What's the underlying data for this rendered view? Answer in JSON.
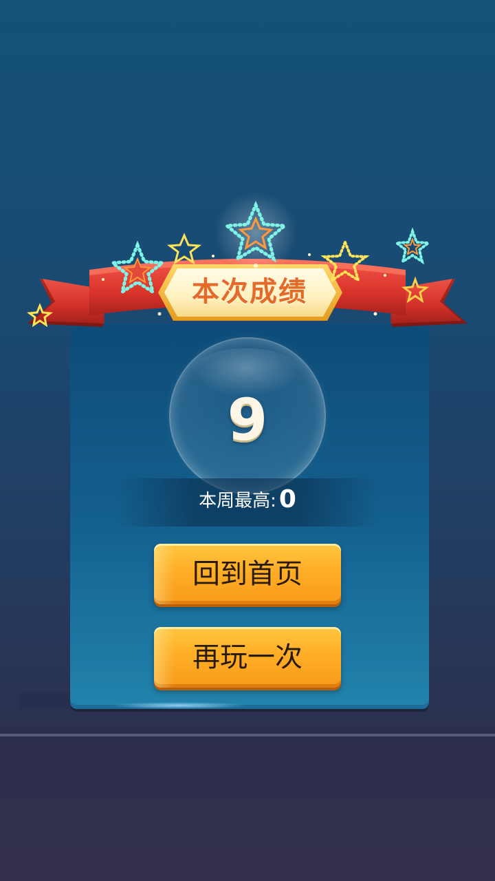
{
  "title": "本次成绩",
  "score": "9",
  "weekly_best": {
    "label": "本周最高:",
    "value": "0"
  },
  "buttons": {
    "home": "回到首页",
    "replay": "再玩一次"
  },
  "colors": {
    "background_top": "#14527a",
    "background_bottom": "#33304d",
    "panel": "#135f8d",
    "button": "#ffae26",
    "ribbon": "#e03a2e",
    "title_plate": "#fff3c4",
    "title_text": "#e36a2a"
  },
  "icons": [
    "star-icon",
    "ribbon-banner"
  ]
}
